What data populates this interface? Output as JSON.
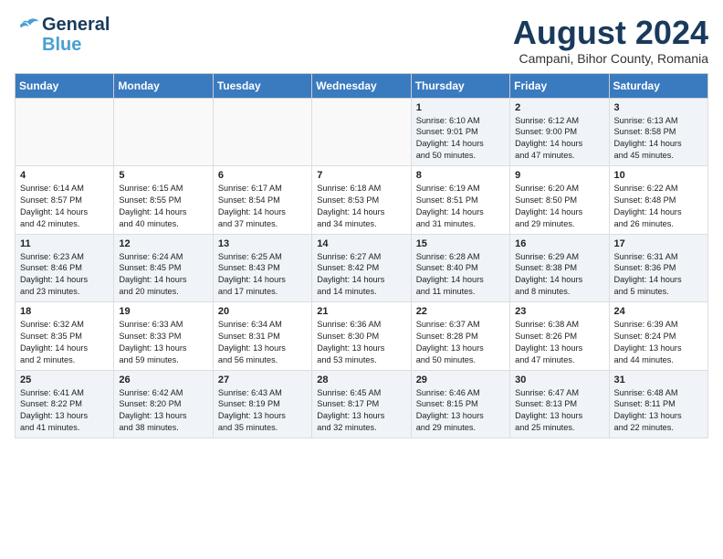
{
  "logo": {
    "line1": "General",
    "line2": "Blue"
  },
  "title": "August 2024",
  "subtitle": "Campani, Bihor County, Romania",
  "days_of_week": [
    "Sunday",
    "Monday",
    "Tuesday",
    "Wednesday",
    "Thursday",
    "Friday",
    "Saturday"
  ],
  "weeks": [
    [
      {
        "day": "",
        "info": ""
      },
      {
        "day": "",
        "info": ""
      },
      {
        "day": "",
        "info": ""
      },
      {
        "day": "",
        "info": ""
      },
      {
        "day": "1",
        "info": "Sunrise: 6:10 AM\nSunset: 9:01 PM\nDaylight: 14 hours\nand 50 minutes."
      },
      {
        "day": "2",
        "info": "Sunrise: 6:12 AM\nSunset: 9:00 PM\nDaylight: 14 hours\nand 47 minutes."
      },
      {
        "day": "3",
        "info": "Sunrise: 6:13 AM\nSunset: 8:58 PM\nDaylight: 14 hours\nand 45 minutes."
      }
    ],
    [
      {
        "day": "4",
        "info": "Sunrise: 6:14 AM\nSunset: 8:57 PM\nDaylight: 14 hours\nand 42 minutes."
      },
      {
        "day": "5",
        "info": "Sunrise: 6:15 AM\nSunset: 8:55 PM\nDaylight: 14 hours\nand 40 minutes."
      },
      {
        "day": "6",
        "info": "Sunrise: 6:17 AM\nSunset: 8:54 PM\nDaylight: 14 hours\nand 37 minutes."
      },
      {
        "day": "7",
        "info": "Sunrise: 6:18 AM\nSunset: 8:53 PM\nDaylight: 14 hours\nand 34 minutes."
      },
      {
        "day": "8",
        "info": "Sunrise: 6:19 AM\nSunset: 8:51 PM\nDaylight: 14 hours\nand 31 minutes."
      },
      {
        "day": "9",
        "info": "Sunrise: 6:20 AM\nSunset: 8:50 PM\nDaylight: 14 hours\nand 29 minutes."
      },
      {
        "day": "10",
        "info": "Sunrise: 6:22 AM\nSunset: 8:48 PM\nDaylight: 14 hours\nand 26 minutes."
      }
    ],
    [
      {
        "day": "11",
        "info": "Sunrise: 6:23 AM\nSunset: 8:46 PM\nDaylight: 14 hours\nand 23 minutes."
      },
      {
        "day": "12",
        "info": "Sunrise: 6:24 AM\nSunset: 8:45 PM\nDaylight: 14 hours\nand 20 minutes."
      },
      {
        "day": "13",
        "info": "Sunrise: 6:25 AM\nSunset: 8:43 PM\nDaylight: 14 hours\nand 17 minutes."
      },
      {
        "day": "14",
        "info": "Sunrise: 6:27 AM\nSunset: 8:42 PM\nDaylight: 14 hours\nand 14 minutes."
      },
      {
        "day": "15",
        "info": "Sunrise: 6:28 AM\nSunset: 8:40 PM\nDaylight: 14 hours\nand 11 minutes."
      },
      {
        "day": "16",
        "info": "Sunrise: 6:29 AM\nSunset: 8:38 PM\nDaylight: 14 hours\nand 8 minutes."
      },
      {
        "day": "17",
        "info": "Sunrise: 6:31 AM\nSunset: 8:36 PM\nDaylight: 14 hours\nand 5 minutes."
      }
    ],
    [
      {
        "day": "18",
        "info": "Sunrise: 6:32 AM\nSunset: 8:35 PM\nDaylight: 14 hours\nand 2 minutes."
      },
      {
        "day": "19",
        "info": "Sunrise: 6:33 AM\nSunset: 8:33 PM\nDaylight: 13 hours\nand 59 minutes."
      },
      {
        "day": "20",
        "info": "Sunrise: 6:34 AM\nSunset: 8:31 PM\nDaylight: 13 hours\nand 56 minutes."
      },
      {
        "day": "21",
        "info": "Sunrise: 6:36 AM\nSunset: 8:30 PM\nDaylight: 13 hours\nand 53 minutes."
      },
      {
        "day": "22",
        "info": "Sunrise: 6:37 AM\nSunset: 8:28 PM\nDaylight: 13 hours\nand 50 minutes."
      },
      {
        "day": "23",
        "info": "Sunrise: 6:38 AM\nSunset: 8:26 PM\nDaylight: 13 hours\nand 47 minutes."
      },
      {
        "day": "24",
        "info": "Sunrise: 6:39 AM\nSunset: 8:24 PM\nDaylight: 13 hours\nand 44 minutes."
      }
    ],
    [
      {
        "day": "25",
        "info": "Sunrise: 6:41 AM\nSunset: 8:22 PM\nDaylight: 13 hours\nand 41 minutes."
      },
      {
        "day": "26",
        "info": "Sunrise: 6:42 AM\nSunset: 8:20 PM\nDaylight: 13 hours\nand 38 minutes."
      },
      {
        "day": "27",
        "info": "Sunrise: 6:43 AM\nSunset: 8:19 PM\nDaylight: 13 hours\nand 35 minutes."
      },
      {
        "day": "28",
        "info": "Sunrise: 6:45 AM\nSunset: 8:17 PM\nDaylight: 13 hours\nand 32 minutes."
      },
      {
        "day": "29",
        "info": "Sunrise: 6:46 AM\nSunset: 8:15 PM\nDaylight: 13 hours\nand 29 minutes."
      },
      {
        "day": "30",
        "info": "Sunrise: 6:47 AM\nSunset: 8:13 PM\nDaylight: 13 hours\nand 25 minutes."
      },
      {
        "day": "31",
        "info": "Sunrise: 6:48 AM\nSunset: 8:11 PM\nDaylight: 13 hours\nand 22 minutes."
      }
    ]
  ]
}
